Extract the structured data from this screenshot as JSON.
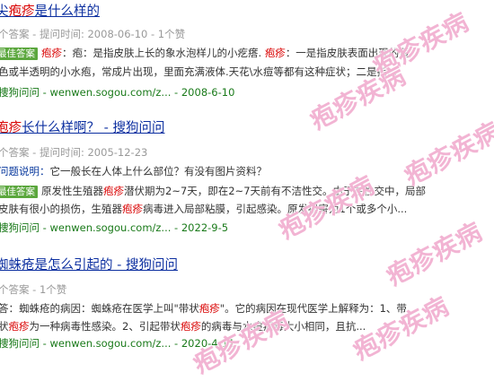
{
  "results": [
    {
      "title_pre": "尖",
      "title_hl": "疱疹",
      "title_post": "是什么样的",
      "meta": "个答案 - 提问时间: 2008-06-10 - 1个赞",
      "badge": "最佳答案",
      "line1_a": "疱疹",
      "line1_b": "：疱：是指皮肤上长的象水泡样儿的小疙瘩. ",
      "line1_c": "疱疹",
      "line1_d": "：一是指皮肤表面出现的黄",
      "line2": "色或半透明的小水疱，常成片出现，里面充满液体.天花\\水痘等都有这种症状；二是指...",
      "url": "捜狗问问 - wenwen.sogou.com/z...",
      "date": " - 2008-6-10"
    },
    {
      "title_pre": "",
      "title_hl": "疱疹",
      "title_post": "长什么样啊？ - 搜狗问问",
      "meta": "个答案 - 提问时间: 2005-12-23",
      "desc_label": "问题说明：",
      "desc": "它一般长在人体上什么部位？有没有图片资料？",
      "badge": "最佳答案",
      "line1_a": "原发性生殖器",
      "line1_b": "疱疹",
      "line1_c": "潜伏期为2~7天，即在2~7天前有不洁性交。由于在性交中，局部",
      "line2_a": "皮肤有很小的损伤，生殖器",
      "line2_b": "疱疹",
      "line2_c": "病毒进入局部粘膜，引起感染。原发损害为1个或多个小...",
      "url": "捜狗问问 - wenwen.sogou.com/z...",
      "date": " - 2022-9-5"
    },
    {
      "title_pre": "蜘蛛疮是怎么引起的 - 搜狗问问",
      "meta": "个答案 - 1个赞",
      "line1_a": "答：蜘蛛疮的病因：蜘蛛疮在医学上叫\"带状",
      "line1_b": "疱疹",
      "line1_c": "\"。它的病因在现代医学上解释为：1、带",
      "line2_a": "状",
      "line2_b": "疱疹",
      "line2_c": "为一种病毒性感染。2、引起带状",
      "line2_d": "疱疹",
      "line2_e": "的病毒与水痘病毒大小相同，且抗...",
      "url": "捜狗问问 - wenwen.sogou.com/z...",
      "date": " - 2020-4-11"
    }
  ],
  "watermark": "疱疹疾病"
}
